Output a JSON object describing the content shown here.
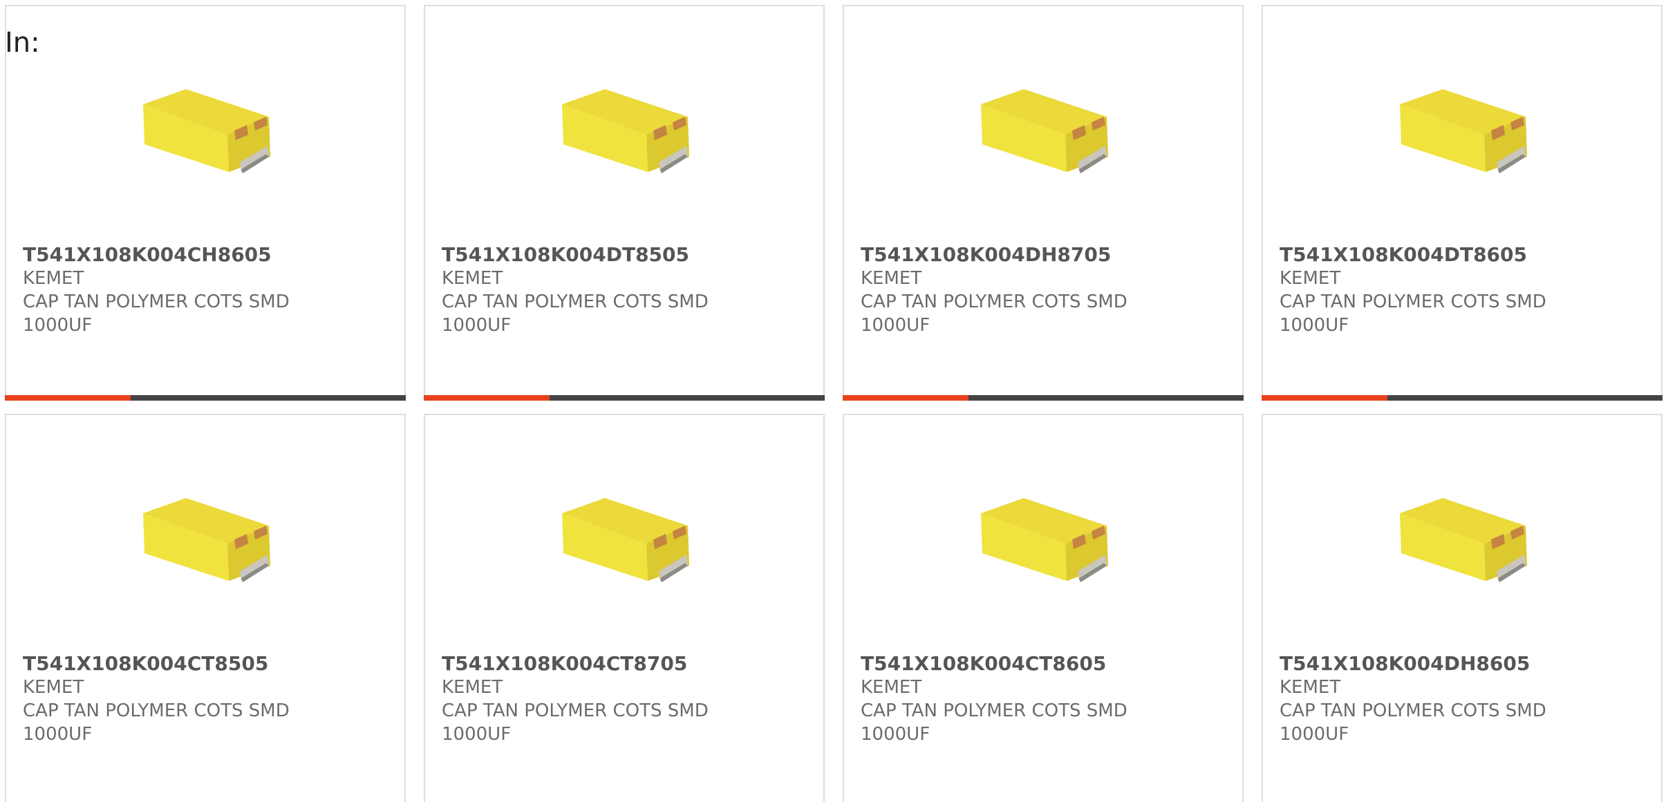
{
  "heading": "In:",
  "colors": {
    "accent": "#e8401c",
    "bar": "#444444",
    "card_border": "#dedede",
    "text": "#6b6b6b"
  },
  "products": [
    {
      "part_number": "T541X108K004CH8605",
      "manufacturer": "KEMET",
      "description_line1": "CAP TAN POLYMER COTS SMD",
      "description_line2": "1000UF",
      "image_icon": "tantalum-capacitor-image"
    },
    {
      "part_number": "T541X108K004DT8505",
      "manufacturer": "KEMET",
      "description_line1": "CAP TAN POLYMER COTS SMD",
      "description_line2": "1000UF",
      "image_icon": "tantalum-capacitor-image"
    },
    {
      "part_number": "T541X108K004DH8705",
      "manufacturer": "KEMET",
      "description_line1": "CAP TAN POLYMER COTS SMD",
      "description_line2": "1000UF",
      "image_icon": "tantalum-capacitor-image"
    },
    {
      "part_number": "T541X108K004DT8605",
      "manufacturer": "KEMET",
      "description_line1": "CAP TAN POLYMER COTS SMD",
      "description_line2": "1000UF",
      "image_icon": "tantalum-capacitor-image"
    },
    {
      "part_number": "T541X108K004CT8505",
      "manufacturer": "KEMET",
      "description_line1": "CAP TAN POLYMER COTS SMD",
      "description_line2": "1000UF",
      "image_icon": "tantalum-capacitor-image"
    },
    {
      "part_number": "T541X108K004CT8705",
      "manufacturer": "KEMET",
      "description_line1": "CAP TAN POLYMER COTS SMD",
      "description_line2": "1000UF",
      "image_icon": "tantalum-capacitor-image"
    },
    {
      "part_number": "T541X108K004CT8605",
      "manufacturer": "KEMET",
      "description_line1": "CAP TAN POLYMER COTS SMD",
      "description_line2": "1000UF",
      "image_icon": "tantalum-capacitor-image"
    },
    {
      "part_number": "T541X108K004DH8605",
      "manufacturer": "KEMET",
      "description_line1": "CAP TAN POLYMER COTS SMD",
      "description_line2": "1000UF",
      "image_icon": "tantalum-capacitor-image"
    }
  ]
}
